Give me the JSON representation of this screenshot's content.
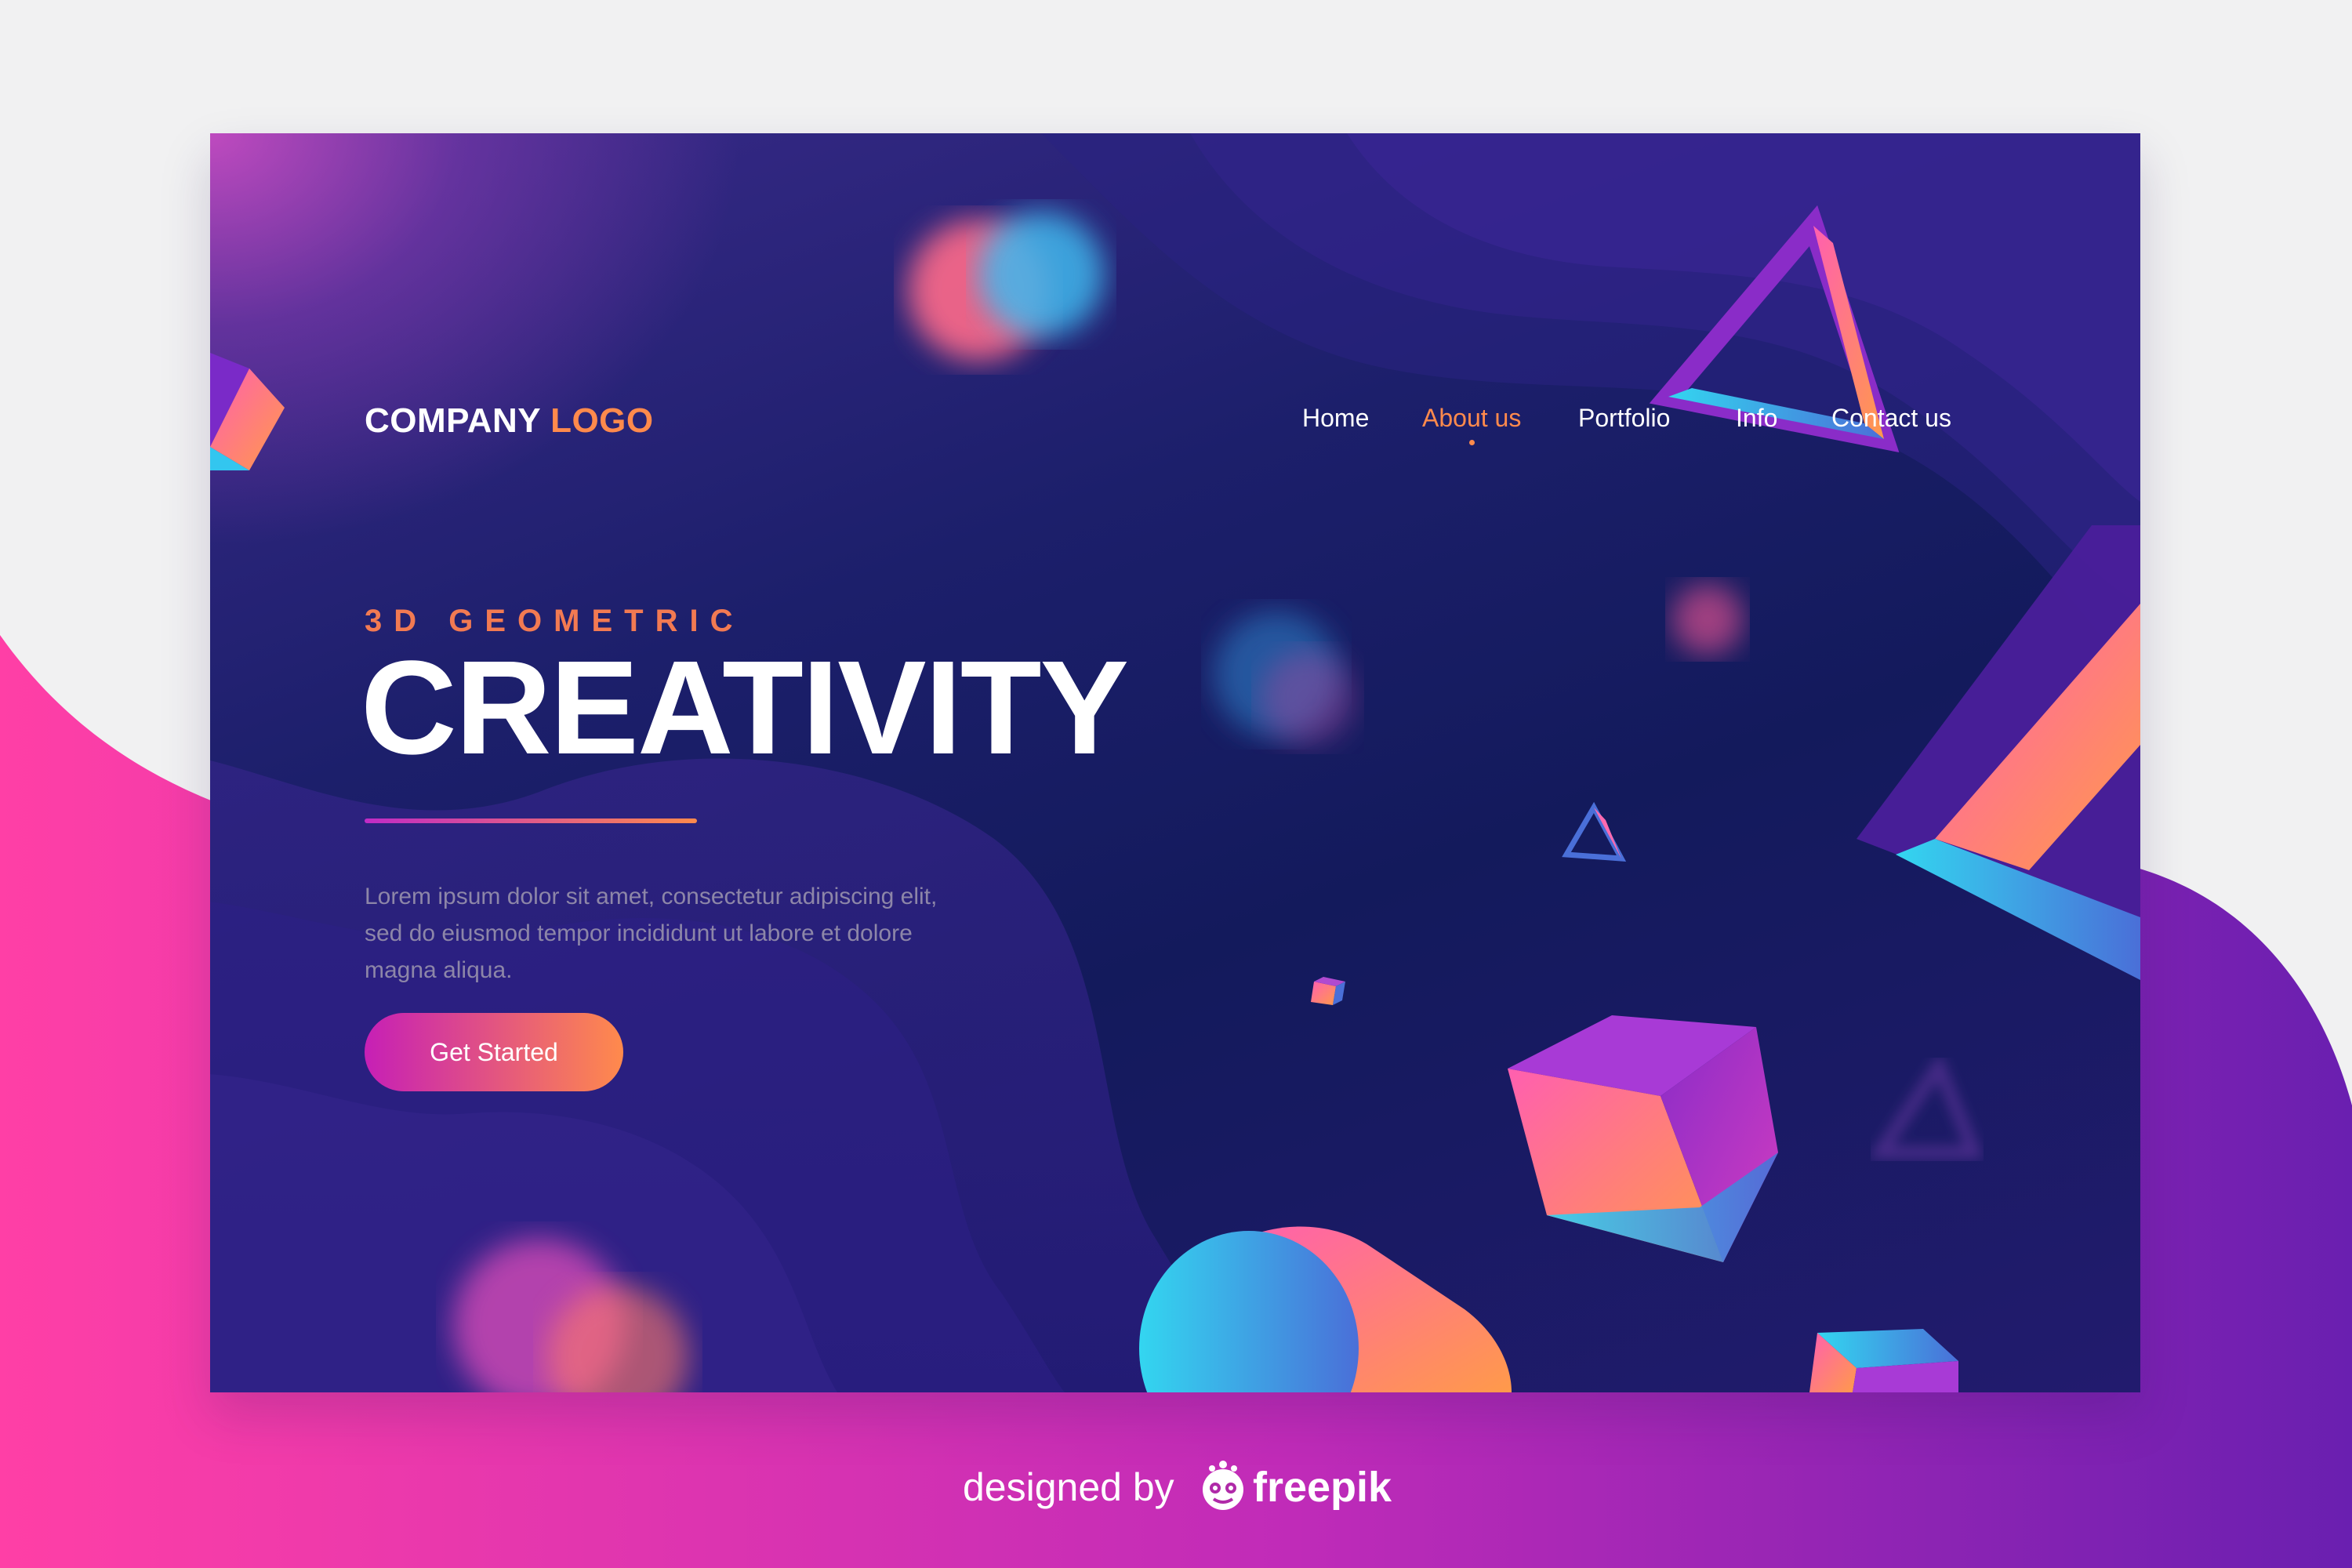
{
  "logo": {
    "text_main": "COMPANY",
    "text_accent": "LOGO"
  },
  "nav": {
    "items": [
      {
        "label": "Home",
        "active": false
      },
      {
        "label": "About us",
        "active": true
      },
      {
        "label": "Portfolio",
        "active": false
      },
      {
        "label": "Info",
        "active": false
      },
      {
        "label": "Contact us",
        "active": false
      }
    ]
  },
  "hero": {
    "eyebrow": "3D GEOMETRIC",
    "title": "CREATIVITY",
    "body": "Lorem ipsum dolor sit amet, consectetur adipiscing elit, sed do eiusmod tempor incididunt ut labore et dolore magna aliqua.",
    "cta_label": "Get Started"
  },
  "credit": {
    "prefix": "designed by",
    "brand": "freepik"
  },
  "colors": {
    "accent_orange": "#ff8a4c",
    "accent_magenta": "#c61fb6",
    "background_navy": "#131a5c",
    "page_pink": "#ff3fa4",
    "page_purple": "#6a1fb0"
  },
  "icons": {
    "credit_mark": "freepik-mascot-icon"
  }
}
